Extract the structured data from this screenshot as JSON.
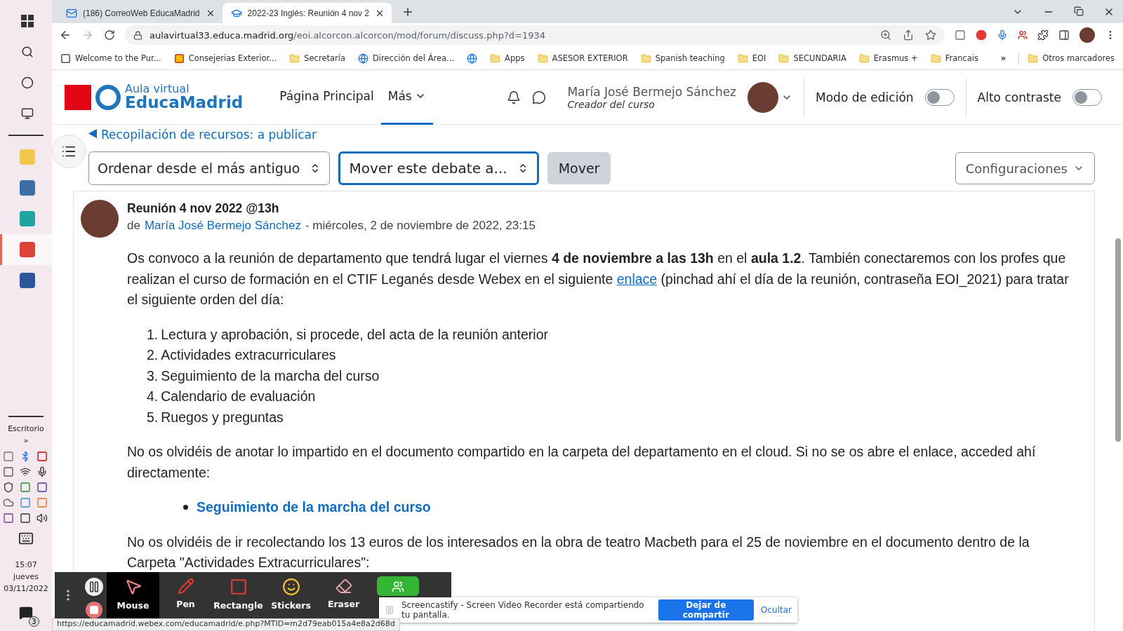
{
  "taskbar": {
    "desktop_label": "Escritorio",
    "chevron": "»",
    "time": "15:07",
    "day": "jueves",
    "date": "03/11/2022",
    "notification_count": "3"
  },
  "browser": {
    "tabs": [
      {
        "title": "(186) CorreoWeb EducaMadrid",
        "selected": false,
        "kind": "mail"
      },
      {
        "title": "2022-23 Inglés: Reunión 4 nov 2",
        "selected": true,
        "kind": "course"
      }
    ],
    "url_host": "aulavirtual33.educa.madrid.org",
    "url_path": "/eoi.alcorcon.alcorcon/mod/forum/discuss.php?d=1934",
    "bookmarks": [
      {
        "label": "Welcome to the Pur...",
        "kind": "site"
      },
      {
        "label": "Consejerias Exterior...",
        "kind": "flag"
      },
      {
        "label": "Secretaría",
        "kind": "folder"
      },
      {
        "label": "Dirección del Área...",
        "kind": "globe"
      },
      {
        "kind": "globe"
      },
      {
        "label": "Apps",
        "kind": "folder"
      },
      {
        "label": "ASESOR EXTERIOR",
        "kind": "folder"
      },
      {
        "label": "Spanish teaching",
        "kind": "folder"
      },
      {
        "label": "EOI",
        "kind": "folder"
      },
      {
        "label": "SECUNDARIA",
        "kind": "folder"
      },
      {
        "label": "Erasmus +",
        "kind": "folder"
      },
      {
        "label": "Francais",
        "kind": "folder"
      }
    ],
    "more_bookmarks": "»",
    "other_bookmarks": "Otros marcadores"
  },
  "site": {
    "logo_line1": "Aula virtual",
    "logo_line2": "EducaMadrid",
    "nav": [
      {
        "label": "Página Principal",
        "selected": false
      },
      {
        "label": "Más",
        "selected": true
      }
    ],
    "user_name": "María José Bermejo Sánchez",
    "user_role": "Creador del curso",
    "toggles": [
      {
        "label": "Modo de edición",
        "on": false
      },
      {
        "label": "Alto contraste",
        "on": false
      }
    ]
  },
  "back_link": "Recopilación de recursos: a publicar",
  "controls": {
    "sort": "Ordenar desde el más antiguo",
    "move_select": "Mover este debate a...",
    "move_button": "Mover",
    "settings": "Configuraciones"
  },
  "post": {
    "title": "Reunión 4 nov 2022 @13h",
    "by": "de",
    "author": "María José Bermejo Sánchez",
    "date": "- miércoles, 2 de noviembre de 2022, 23:15",
    "intro_before": "Os convoco a la reunión de departamento que tendrá lugar el viernes **4 de noviembre a las 13h** en el **aula 1.2**. También conectaremos con los profes que realizan el curso de formación en el CTIF Leganés desde Webex en el siguiente",
    "intro_link": "enlace",
    "intro_after": "(pinchad ahí el día de la reunión, contraseña EOI_2021) para tratar el siguiente orden del día:",
    "agenda": [
      {
        "number": "1.",
        "text": "Lectura y aprobación, si procede, del acta de la reunión anterior"
      },
      {
        "number": "2.",
        "text": "Actividades extracurriculares"
      },
      {
        "number": "3.",
        "text": "Seguimiento de la marcha del curso"
      },
      {
        "number": "4.",
        "text": "Calendario de evaluación"
      },
      {
        "number": "5.",
        "text": "Ruegos y preguntas"
      }
    ],
    "note": "No os olvidéis de anotar lo impartido en el documento compartido en la carpeta del departamento en el cloud. Si no se os abre el enlace, acceded ahí directamente:",
    "note_links": [
      "Seguimiento de la marcha del curso"
    ],
    "reminder": "No os olvidéis de ir recolectando los 13 euros de los interesados en la obra de teatro Macbeth para el 25 de noviembre en el documento dentro de la Carpeta \"Actividades Extracurriculares\":"
  },
  "recorder": {
    "tools": [
      {
        "label": "Mouse",
        "kind": "mouse",
        "selected": true
      },
      {
        "label": "Pen",
        "kind": "pen",
        "selected": false
      },
      {
        "label": "Rectangle",
        "kind": "rectangle",
        "selected": false
      },
      {
        "label": "Stickers",
        "kind": "stickers",
        "selected": false
      },
      {
        "label": "Eraser",
        "kind": "eraser",
        "selected": false
      }
    ]
  },
  "share_notice": {
    "text": "Screencastify - Screen Video Recorder está compartiendo tu pantalla.",
    "stop_button": "Dejar de compartir",
    "hide_link": "Ocultar"
  },
  "status_url": "https://educamadrid.webex.com/educamadrid/e.php?MTID=m2d79eab015a4e8a2d68d"
}
